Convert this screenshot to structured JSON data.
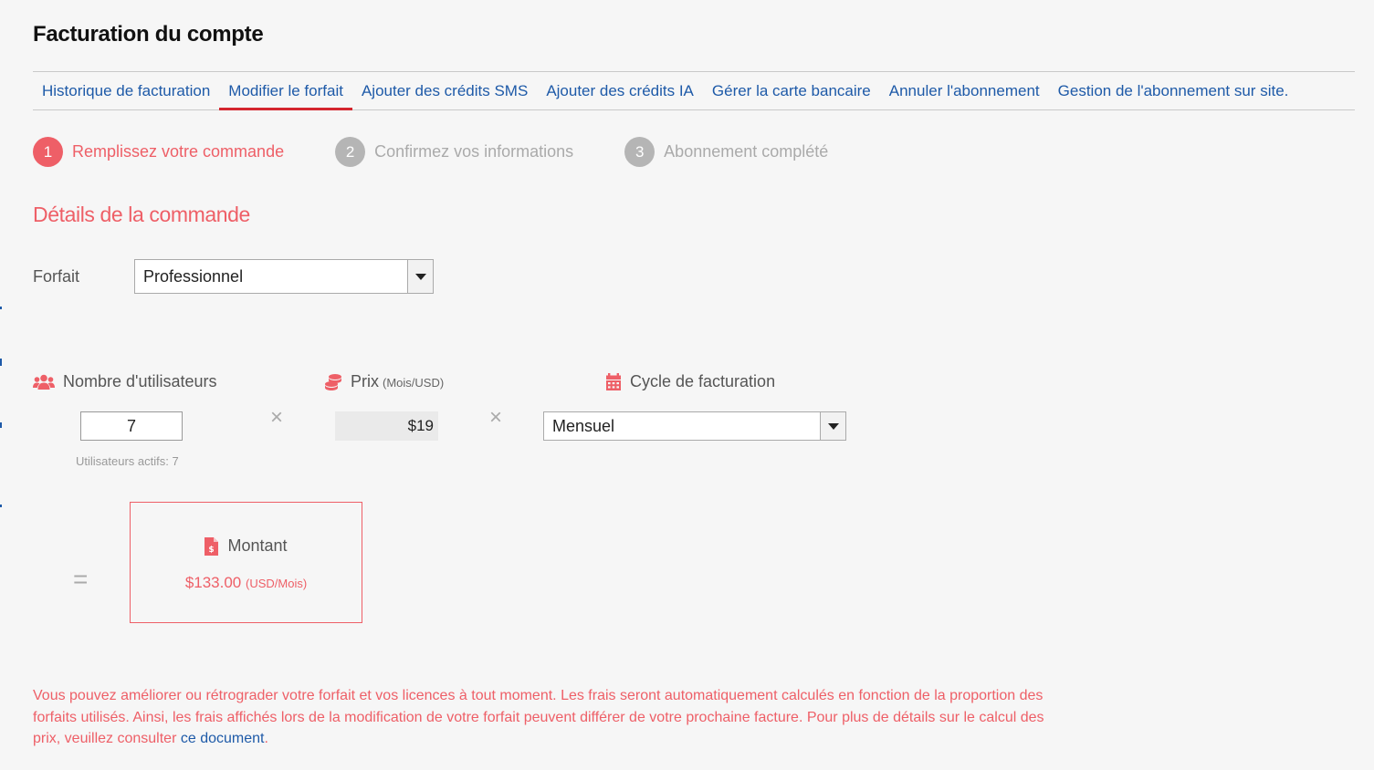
{
  "page": {
    "title": "Facturation du compte"
  },
  "tabs": [
    {
      "label": "Historique de facturation",
      "active": false
    },
    {
      "label": "Modifier le forfait",
      "active": true
    },
    {
      "label": "Ajouter des crédits SMS",
      "active": false
    },
    {
      "label": "Ajouter des crédits IA",
      "active": false
    },
    {
      "label": "Gérer la carte bancaire",
      "active": false
    },
    {
      "label": "Annuler l'abonnement",
      "active": false
    },
    {
      "label": "Gestion de l'abonnement sur site.",
      "active": false
    }
  ],
  "steps": [
    {
      "number": "1",
      "label": "Remplissez votre commande",
      "state": "active"
    },
    {
      "number": "2",
      "label": "Confirmez vos informations",
      "state": "inactive"
    },
    {
      "number": "3",
      "label": "Abonnement complété",
      "state": "inactive"
    }
  ],
  "order": {
    "section_title": "Détails de la commande",
    "forfait_label": "Forfait",
    "forfait_value": "Professionnel",
    "users_label": "Nombre d'utilisateurs",
    "users_value": "7",
    "active_users": "Utilisateurs actifs: 7",
    "price_label": "Prix",
    "price_unit": "(Mois/USD)",
    "price_value": "$19",
    "cycle_label": "Cycle de facturation",
    "cycle_value": "Mensuel",
    "times_symbol": "×",
    "equals_symbol": "=",
    "amount_label": "Montant",
    "amount_value": "$133.00",
    "amount_unit": "(USD/Mois)"
  },
  "note": {
    "text": "Vous pouvez améliorer ou rétrograder votre forfait et vos licences à tout moment. Les frais seront automatiquement calculés en fonction de la proportion des forfaits utilisés. Ainsi, les frais affichés lors de la modification de votre forfait peuvent différer de votre prochaine facture. Pour plus de détails sur le calcul des prix, veuillez consulter ",
    "link_text": "ce document",
    "suffix": "."
  },
  "colors": {
    "accent": "#ee5f67",
    "tab_active_underline": "#d4262e",
    "link": "#1e5aa8",
    "background": "#f6f6f6"
  },
  "icons": {
    "users": "users-icon",
    "price": "coins-icon",
    "cycle": "calendar-icon",
    "amount": "invoice-dollar-icon",
    "dropdown": "caret-down-icon"
  }
}
